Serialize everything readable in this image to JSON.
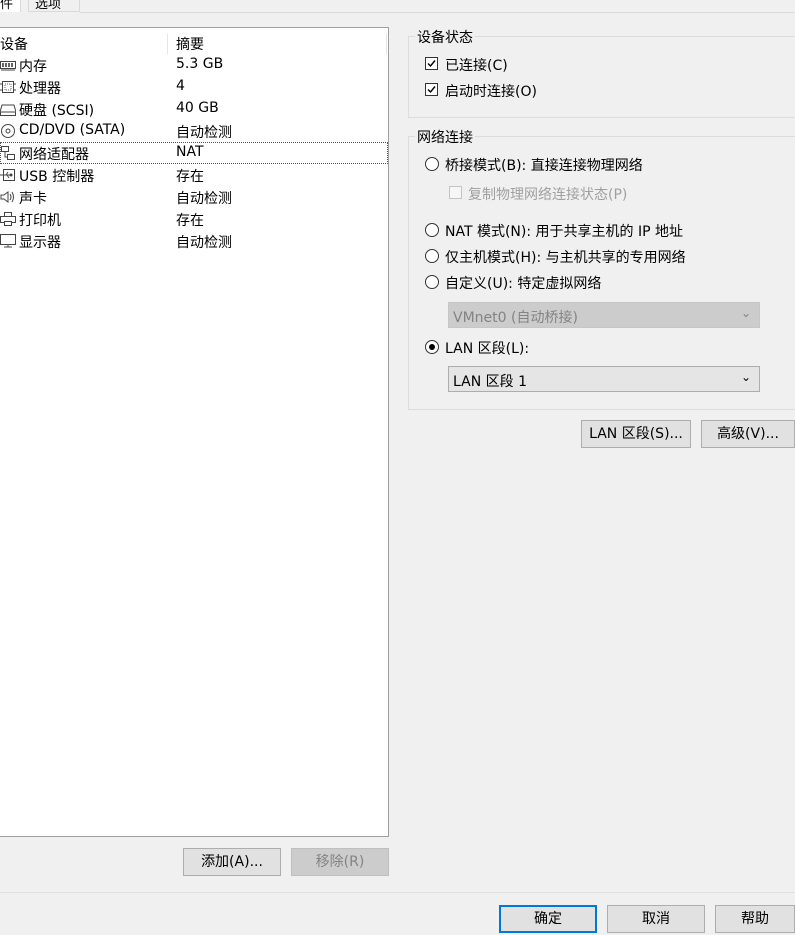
{
  "tabs": [
    {
      "label": "件"
    },
    {
      "label": "选项"
    }
  ],
  "device_list": {
    "columns": [
      "设备",
      "摘要"
    ],
    "rows": [
      {
        "name": "内存",
        "summary": "5.3 GB",
        "icon": "memory-icon"
      },
      {
        "name": "处理器",
        "summary": "4",
        "icon": "processor-icon"
      },
      {
        "name": "硬盘 (SCSI)",
        "summary": "40 GB",
        "icon": "hard-disk-icon"
      },
      {
        "name": "CD/DVD (SATA)",
        "summary": "自动检测",
        "icon": "cd-dvd-icon"
      },
      {
        "name": "网络适配器",
        "summary": "NAT",
        "icon": "network-adapter-icon"
      },
      {
        "name": "USB 控制器",
        "summary": "存在",
        "icon": "usb-icon"
      },
      {
        "name": "声卡",
        "summary": "自动检测",
        "icon": "speaker-icon"
      },
      {
        "name": "打印机",
        "summary": "存在",
        "icon": "printer-icon"
      },
      {
        "name": "显示器",
        "summary": "自动检测",
        "icon": "monitor-icon"
      }
    ],
    "selected_row": 4
  },
  "list_buttons": {
    "add": "添加(A)...",
    "remove": "移除(R)"
  },
  "device_status": {
    "title": "设备状态",
    "connected": {
      "label": "已连接(C)",
      "checked": true
    },
    "connect_at_power_on": {
      "label": "启动时连接(O)",
      "checked": true
    }
  },
  "network_connection": {
    "title": "网络连接",
    "bridged": {
      "label": "桥接模式(B): 直接连接物理网络",
      "selected": false
    },
    "replicate": {
      "label": "复制物理网络连接状态(P)",
      "checked": false,
      "enabled": false
    },
    "nat": {
      "label": "NAT 模式(N): 用于共享主机的 IP 地址",
      "selected": false
    },
    "host_only": {
      "label": "仅主机模式(H): 与主机共享的专用网络",
      "selected": false
    },
    "custom": {
      "label": "自定义(U): 特定虚拟网络",
      "selected": false
    },
    "custom_value": "VMnet0 (自动桥接)",
    "lan_segment": {
      "label": "LAN 区段(L):",
      "selected": true
    },
    "lan_segment_value": "LAN 区段 1"
  },
  "side_buttons": {
    "lan_segments": "LAN 区段(S)...",
    "advanced": "高级(V)..."
  },
  "dialog_buttons": {
    "ok": "确定",
    "cancel": "取消",
    "help": "帮助"
  }
}
